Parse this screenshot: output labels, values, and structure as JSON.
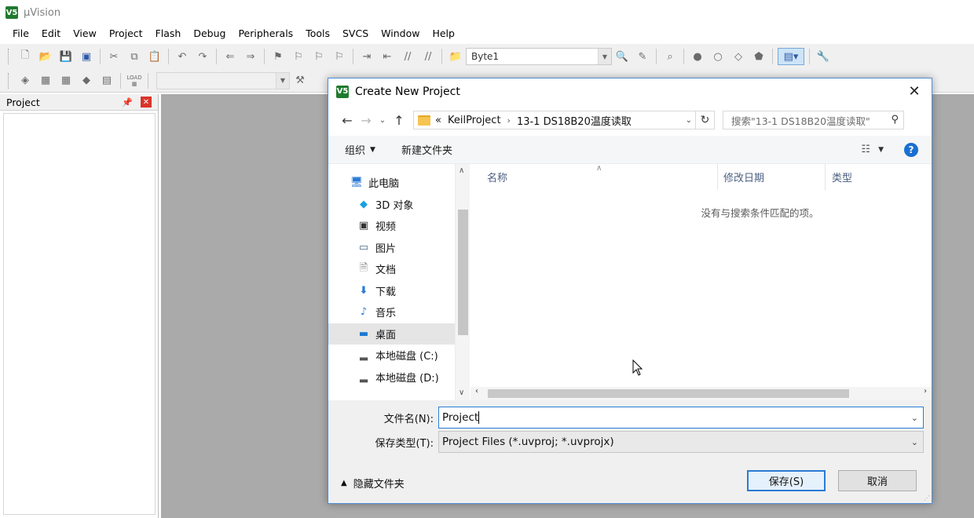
{
  "app": {
    "title": "µVision",
    "logo": "V5"
  },
  "menu": [
    "File",
    "Edit",
    "View",
    "Project",
    "Flash",
    "Debug",
    "Peripherals",
    "Tools",
    "SVCS",
    "Window",
    "Help"
  ],
  "toolbar": {
    "find_combo_value": "Byte1",
    "load_label": "LOAD"
  },
  "project_panel": {
    "title": "Project"
  },
  "dialog": {
    "title": "Create New Project",
    "breadcrumb": [
      "KeilProject",
      "13-1 DS18B20温度读取"
    ],
    "breadcrumb_prefix": "«",
    "search_placeholder": "搜索\"13-1 DS18B20温度读取\"",
    "organize_label": "组织",
    "new_folder_label": "新建文件夹",
    "nav_tree": [
      {
        "label": "此电脑",
        "icon": "computer-icon"
      },
      {
        "label": "3D 对象",
        "icon": "cube-icon"
      },
      {
        "label": "视频",
        "icon": "video-icon"
      },
      {
        "label": "图片",
        "icon": "picture-icon"
      },
      {
        "label": "文档",
        "icon": "document-icon"
      },
      {
        "label": "下载",
        "icon": "download-icon"
      },
      {
        "label": "音乐",
        "icon": "music-icon"
      },
      {
        "label": "桌面",
        "icon": "desktop-icon",
        "selected": true
      },
      {
        "label": "本地磁盘 (C:)",
        "icon": "drive-icon"
      },
      {
        "label": "本地磁盘 (D:)",
        "icon": "drive-icon"
      }
    ],
    "columns": [
      "名称",
      "修改日期",
      "类型"
    ],
    "empty_message": "没有与搜索条件匹配的项。",
    "filename_label": "文件名(N):",
    "filename_value": "Project",
    "filetype_label": "保存类型(T):",
    "filetype_value": "Project Files (*.uvproj; *.uvprojx)",
    "hide_folders_label": "隐藏文件夹",
    "save_button": "保存(S)",
    "cancel_button": "取消",
    "help_label": "?"
  },
  "colors": {
    "accent": "#2a7bd5",
    "workspace": "#aaaaaa",
    "logo_green": "#1f7a2e",
    "help_blue": "#1a6fd1"
  }
}
